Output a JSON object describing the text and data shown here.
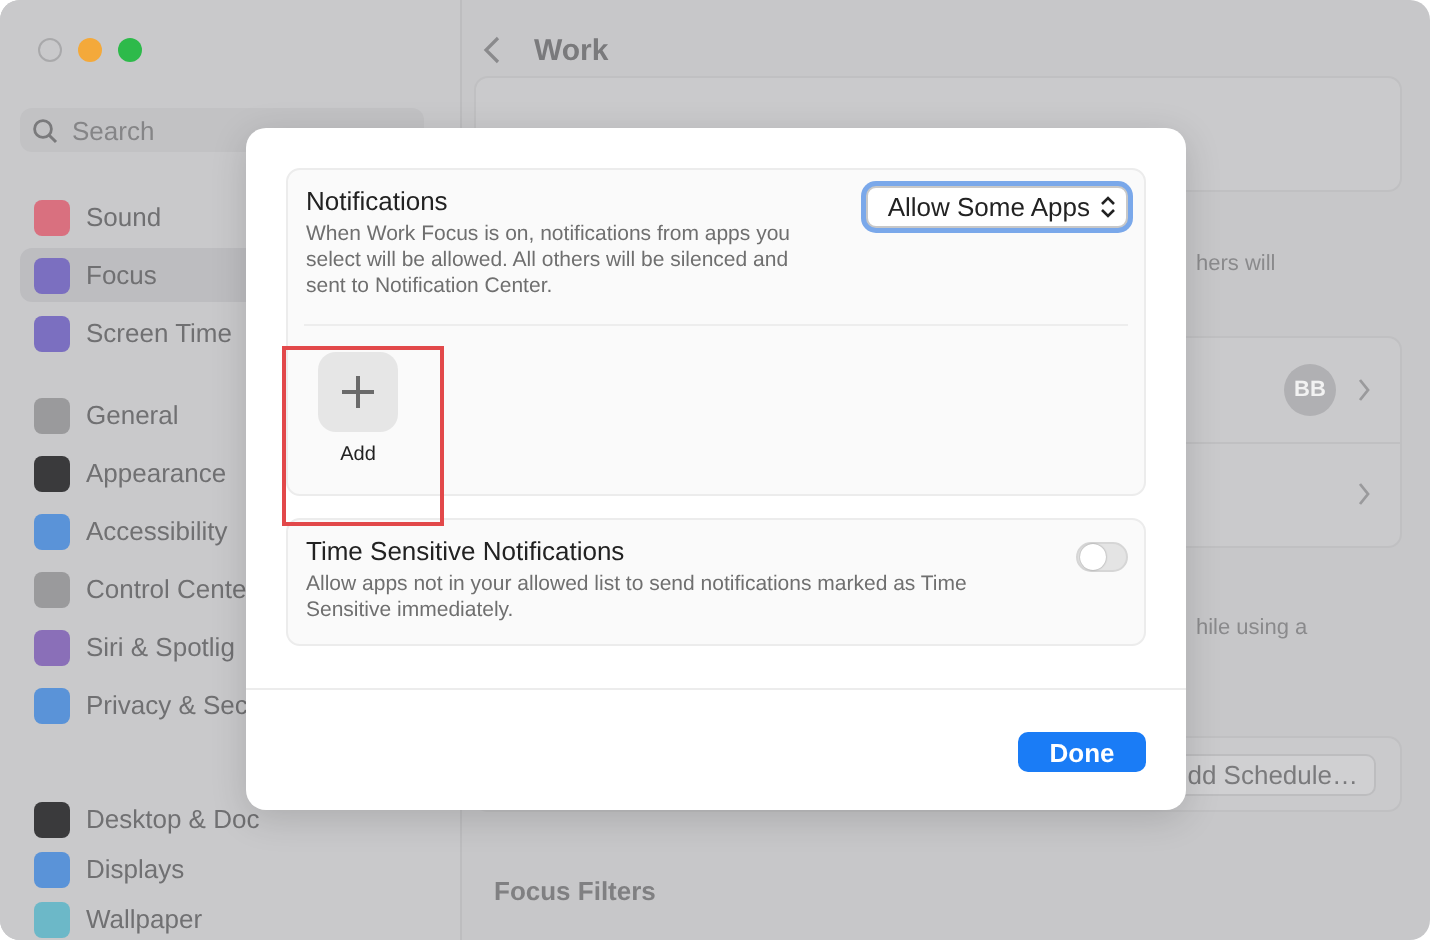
{
  "sidebar": {
    "search": {
      "placeholder": "Search"
    },
    "groups": [
      [
        {
          "label": "Sound",
          "color": "#d9707f",
          "selected": false
        },
        {
          "label": "Focus",
          "color": "#7b6fc0",
          "selected": true
        },
        {
          "label": "Screen Time",
          "color": "#7b6fc0",
          "selected": false
        }
      ],
      [
        {
          "label": "General",
          "color": "#9a9a9c",
          "selected": false
        },
        {
          "label": "Appearance",
          "color": "#3a3a3c",
          "selected": false
        },
        {
          "label": "Accessibility",
          "color": "#5a93d8",
          "selected": false
        },
        {
          "label": "Control Cente",
          "color": "#9a9a9c",
          "selected": false
        },
        {
          "label": "Siri & Spotlig",
          "color": "#8a6fb8",
          "selected": false
        },
        {
          "label": "Privacy & Sec",
          "color": "#5a93d8",
          "selected": false
        }
      ],
      [
        {
          "label": "Desktop & Doc",
          "color": "#3a3a3c",
          "selected": false
        },
        {
          "label": "Displays",
          "color": "#5a93d8",
          "selected": false
        },
        {
          "label": "Wallpaper",
          "color": "#6cb8c8",
          "selected": false
        }
      ]
    ]
  },
  "main": {
    "title": "Work",
    "fragment_1": "hers will",
    "avatar": "BB",
    "fragment_2": "hile using a",
    "schedule_button": "dd Schedule…",
    "section_title": "Focus Filters"
  },
  "dialog": {
    "notifications": {
      "title": "Notifications",
      "description": "When Work Focus is on, notifications from apps you select will be allowed. All others will be silenced and sent to Notification Center.",
      "popup": "Allow Some Apps",
      "add_label": "Add"
    },
    "time_sensitive": {
      "title": "Time Sensitive Notifications",
      "description": "Allow apps not in your allowed list to send notifications marked as Time Sensitive immediately.",
      "on": false
    },
    "done": "Done"
  }
}
